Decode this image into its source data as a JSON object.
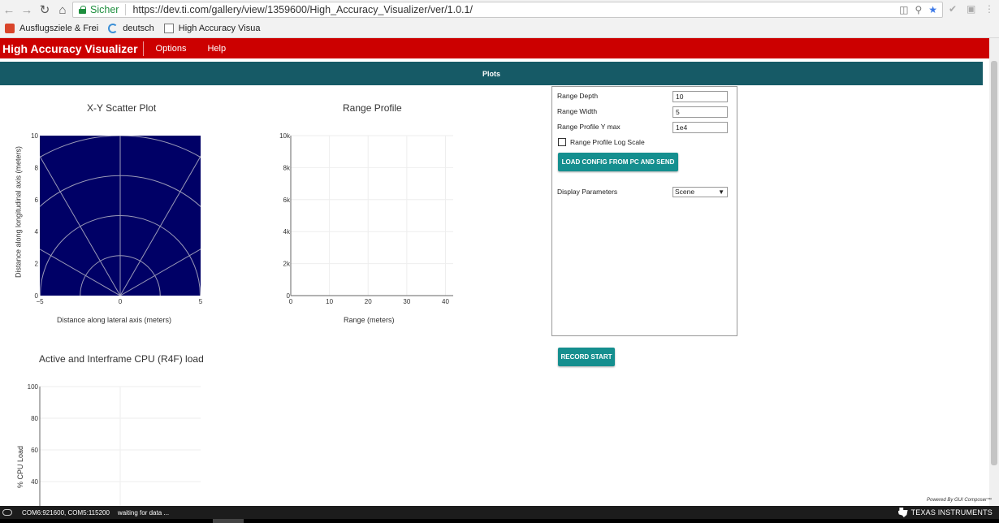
{
  "browser": {
    "secure_label": "Sicher",
    "url": "https://dev.ti.com/gallery/view/1359600/High_Accuracy_Visualizer/ver/1.0.1/",
    "bookmarks": [
      {
        "label": "Ausflugsziele & Frei",
        "icon": "red-tile-icon"
      },
      {
        "label": "deutsch",
        "icon": "swirl-icon"
      },
      {
        "label": "High Accuracy Visua",
        "icon": "page-icon"
      }
    ]
  },
  "app": {
    "title": "High Accuracy Visualizer",
    "menu": [
      "Options",
      "Help"
    ],
    "tab_strip_label": "Plots"
  },
  "charts": {
    "scatter": {
      "title": "X-Y Scatter Plot",
      "xlabel": "Distance along lateral axis (meters)",
      "ylabel": "Distance along longitudinal axis (meters)",
      "xticks": [
        "−5",
        "0",
        "5"
      ],
      "yticks": [
        "0",
        "2",
        "4",
        "6",
        "8",
        "10"
      ],
      "bg_color": "#000066"
    },
    "range_profile": {
      "title": "Range Profile",
      "xlabel": "Range (meters)",
      "xticks": [
        "0",
        "10",
        "20",
        "30",
        "40"
      ],
      "yticks": [
        "0",
        "2k",
        "4k",
        "6k",
        "8k",
        "10k"
      ]
    },
    "cpu": {
      "title": "Active and Interframe CPU (R4F) load",
      "ylabel": "% CPU Load",
      "yticks": [
        "40",
        "60",
        "80",
        "100"
      ]
    }
  },
  "chart_data": [
    {
      "type": "scatter",
      "title": "X-Y Scatter Plot",
      "xlabel": "Distance along lateral axis (meters)",
      "ylabel": "Distance along longitudinal axis (meters)",
      "xlim": [
        -5,
        5
      ],
      "ylim": [
        0,
        10
      ],
      "points": [],
      "range_rings_m": [
        2.5,
        5,
        7.5,
        10
      ],
      "angle_lines_deg": [
        -60,
        -30,
        0,
        30,
        60
      ]
    },
    {
      "type": "line",
      "title": "Range Profile",
      "xlabel": "Range (meters)",
      "xlim": [
        0,
        42
      ],
      "ylim": [
        0,
        10000
      ],
      "series": []
    },
    {
      "type": "line",
      "title": "Active and Interframe CPU (R4F) load",
      "ylabel": "% CPU Load",
      "ylim": [
        30,
        100
      ],
      "series": []
    }
  ],
  "settings": {
    "range_depth_label": "Range Depth",
    "range_depth_value": "10",
    "range_width_label": "Range Width",
    "range_width_value": "5",
    "ymax_label": "Range Profile Y max",
    "ymax_value": "1e4",
    "log_scale_label": "Range Profile Log Scale",
    "log_scale_checked": false,
    "load_config_label": "LOAD CONFIG FROM PC AND SEND",
    "display_params_label": "Display Parameters",
    "display_params_value": "Scene"
  },
  "record_button_label": "RECORD START",
  "footer": {
    "powered_by": "Powered By GUI Composer™",
    "ports": "COM6:921600, COM5:115200",
    "status": "waiting for data ...",
    "brand": "Texas Instruments"
  }
}
